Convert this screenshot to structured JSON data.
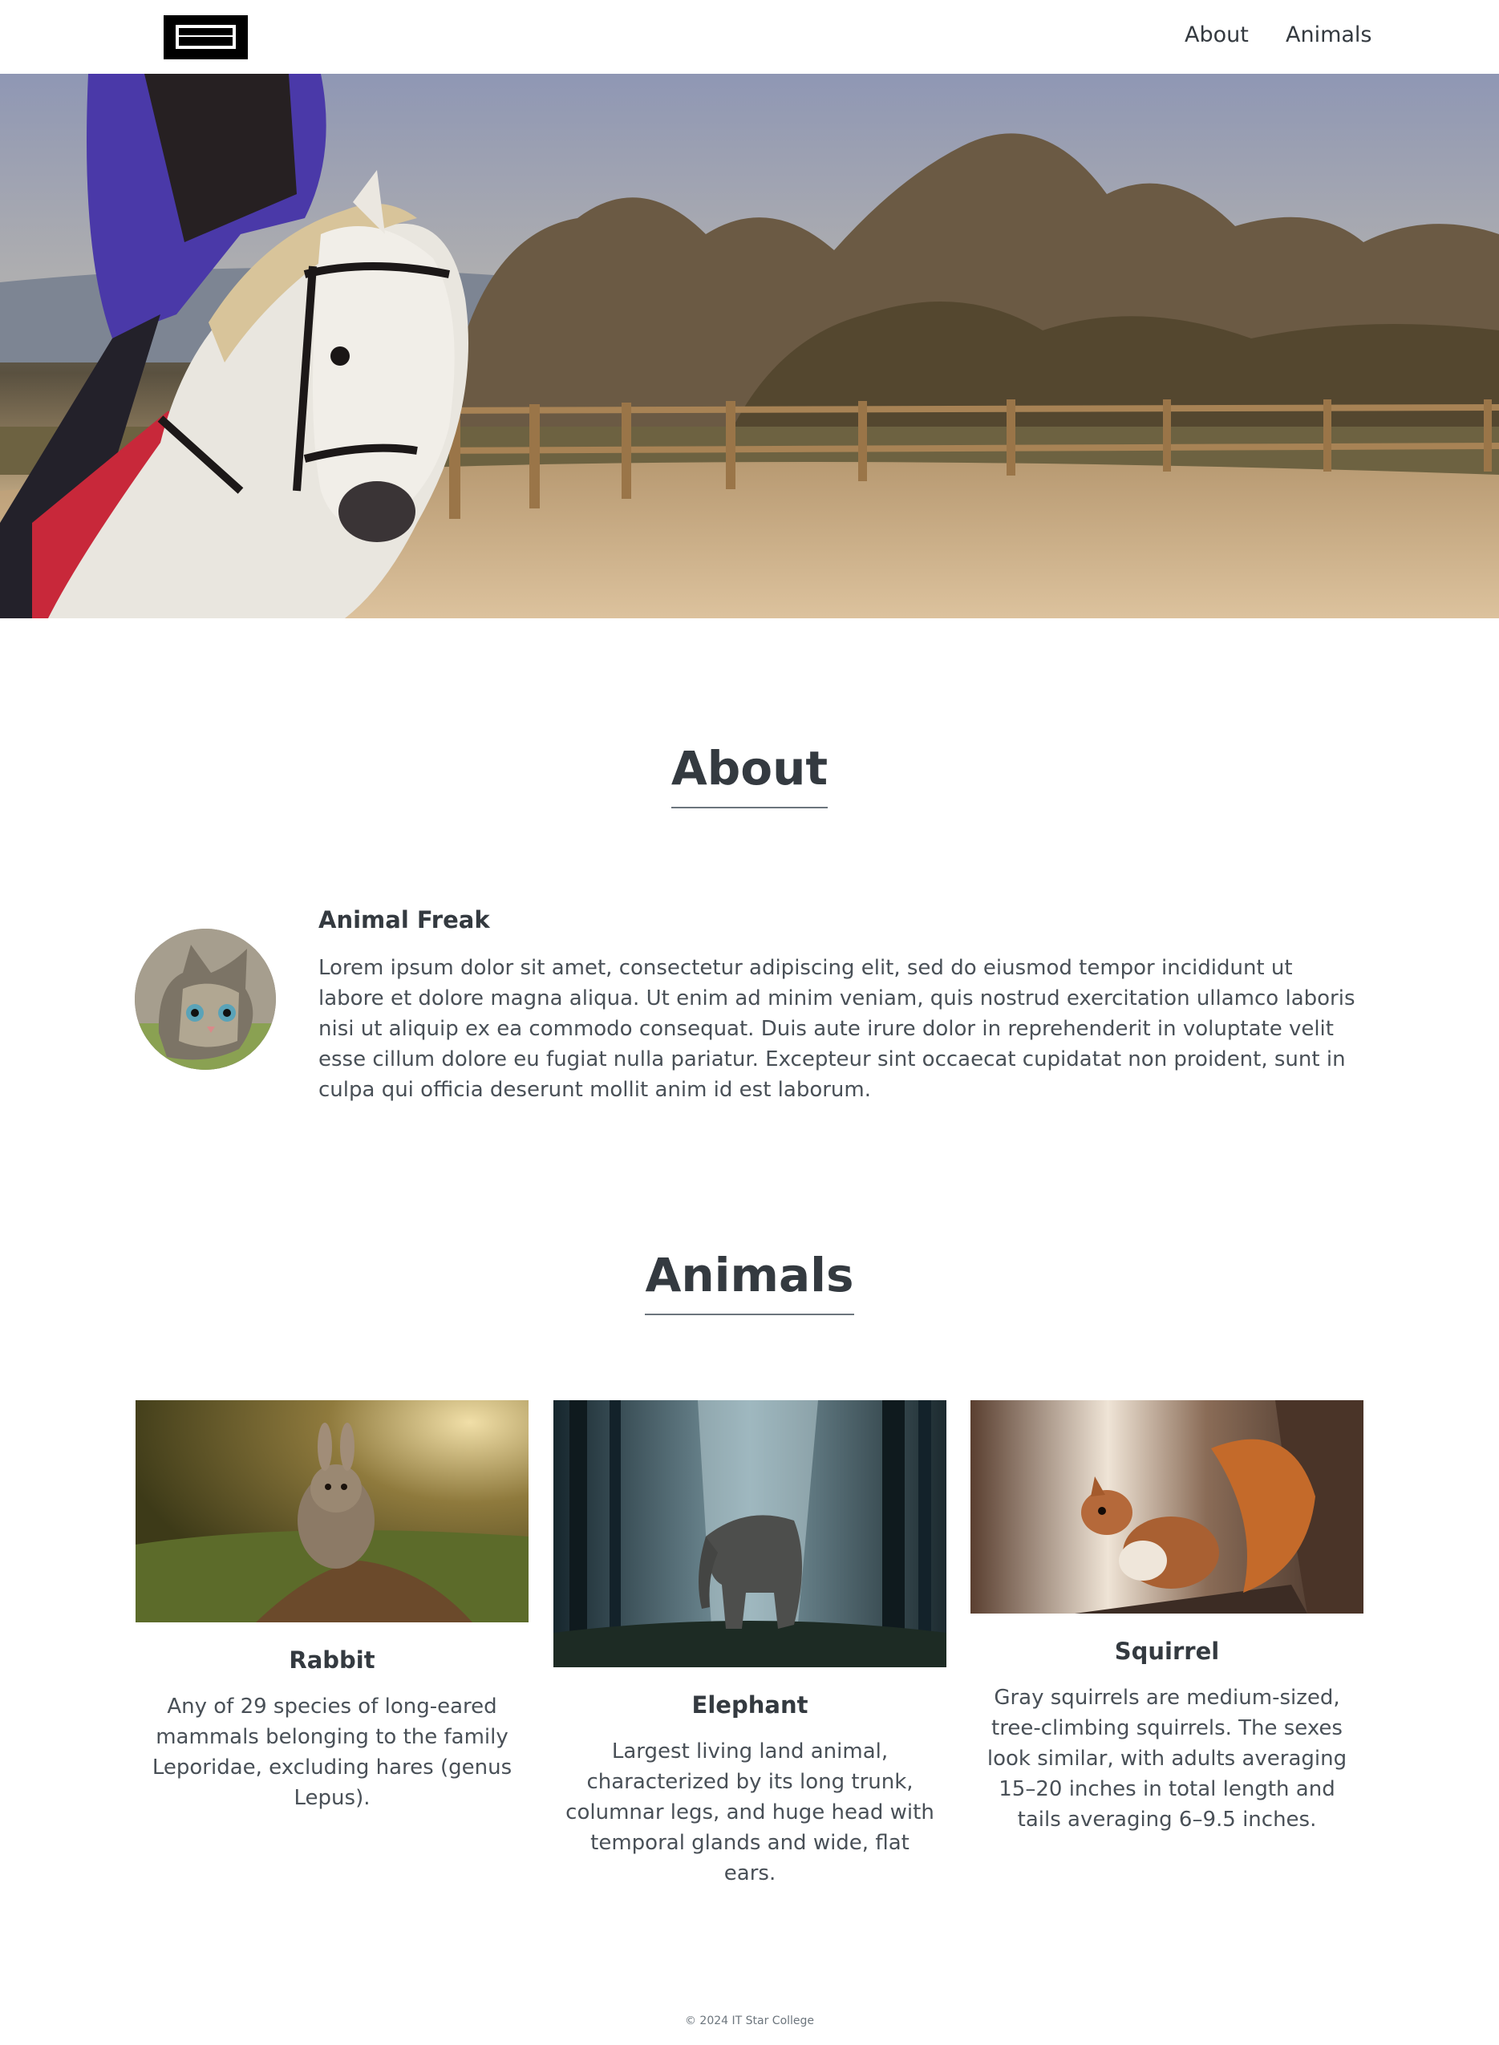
{
  "header": {
    "logo_icon": "menu-logo-icon",
    "nav": [
      {
        "label": "About"
      },
      {
        "label": "Animals"
      }
    ]
  },
  "hero": {
    "image": "horse-rider-paddock-photo"
  },
  "about": {
    "title": "About",
    "avatar": "kitten-photo",
    "name": "Animal Freak",
    "text": "Lorem ipsum dolor sit amet, consectetur adipiscing elit, sed do eiusmod tempor incididunt ut labore et dolore magna aliqua. Ut enim ad minim veniam, quis nostrud exercitation ullamco laboris nisi ut aliquip ex ea commodo consequat. Duis aute irure dolor in reprehenderit in voluptate velit esse cillum dolore eu fugiat nulla pariatur. Excepteur sint occaecat cupidatat non proident, sunt in culpa qui officia deserunt mollit anim id est laborum."
  },
  "animals": {
    "title": "Animals",
    "items": [
      {
        "name": "Rabbit",
        "image": "rabbit-photo",
        "description": "Any of 29 species of long-eared mammals belonging to the family Leporidae, excluding hares (genus Lepus)."
      },
      {
        "name": "Elephant",
        "image": "elephant-photo",
        "description": "Largest living land animal, characterized by its long trunk, columnar legs, and huge head with temporal glands and wide, flat ears."
      },
      {
        "name": "Squirrel",
        "image": "squirrel-photo",
        "description": "Gray squirrels are medium-sized, tree-climbing squirrels. The sexes look similar, with adults averaging 15–20 inches in total length and tails averaging 6–9.5 inches."
      }
    ]
  },
  "footer": {
    "text": "© 2024 IT Star College"
  }
}
